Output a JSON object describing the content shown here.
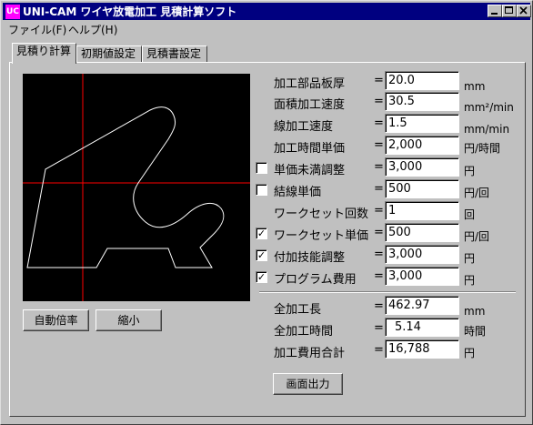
{
  "window": {
    "title": "UNI-CAM ワイヤ放電加工 見積計算ソフト",
    "icon_text": "UC"
  },
  "menu": [
    {
      "label": "ファイル(F)"
    },
    {
      "label": "ヘルプ(H)"
    }
  ],
  "tabs": [
    {
      "label": "見積り計算",
      "active": true
    },
    {
      "label": "初期値設定"
    },
    {
      "label": "見積書設定"
    }
  ],
  "canvas_buttons": {
    "auto_zoom": "自動倍率",
    "shrink": "縮小"
  },
  "params": [
    {
      "label": "加工部品板厚",
      "value": "20.0",
      "unit": "mm"
    },
    {
      "label": "面積加工速度",
      "value": "30.5",
      "unit": "mm²/min"
    },
    {
      "label": "線加工速度",
      "value": "1.5",
      "unit": "mm/min"
    },
    {
      "label": "加工時間単価",
      "value": "2,000",
      "unit": "円/時間"
    },
    {
      "label": "単価未満調整",
      "value": "3,000",
      "unit": "円",
      "checkbox": true,
      "checked": false
    },
    {
      "label": "結線単価",
      "value": "500",
      "unit": "円/回",
      "checkbox": true,
      "checked": false
    },
    {
      "label": "ワークセット回数",
      "value": "1",
      "unit": "回"
    },
    {
      "label": "ワークセット単価",
      "value": "500",
      "unit": "円/回",
      "checkbox": true,
      "checked": true
    },
    {
      "label": "付加技能調整",
      "value": "3,000",
      "unit": "円",
      "checkbox": true,
      "checked": true
    },
    {
      "label": "プログラム費用",
      "value": "3,000",
      "unit": "円",
      "checkbox": true,
      "checked": true
    }
  ],
  "totals": [
    {
      "label": "全加工長",
      "value": "462.97",
      "unit": "mm"
    },
    {
      "label": "全加工時間",
      "value": "5.14",
      "unit": "時間"
    },
    {
      "label": "加工費用合計",
      "value": "16,788",
      "unit": "円"
    }
  ],
  "eq_sign": "=",
  "output_button": "画面出力",
  "colors": {
    "titlebar": "#000080",
    "canvas_bg": "#000000",
    "crosshair": "#ff0000",
    "shape": "#ffffff"
  }
}
